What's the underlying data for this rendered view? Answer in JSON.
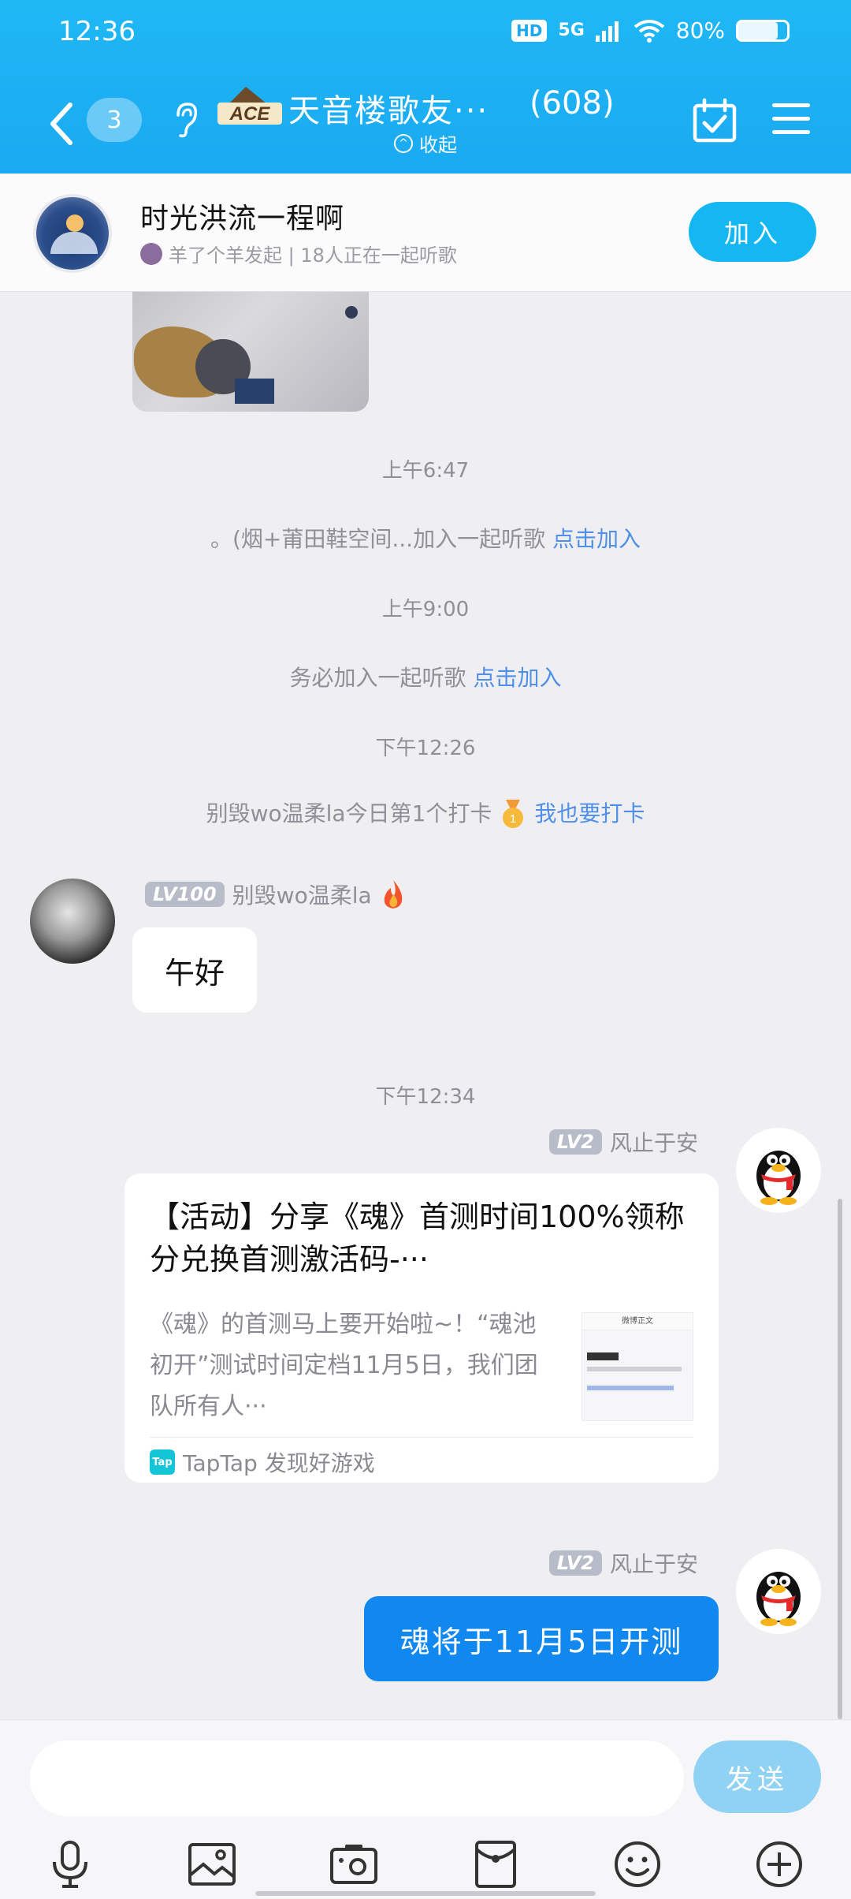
{
  "status_bar": {
    "time": "12:36",
    "network": "5G",
    "hd": "HD",
    "battery": "80%"
  },
  "header": {
    "unread_count": "3",
    "logo_text": "ACE",
    "group_title": "天音楼歌友···",
    "member_count": "(608)",
    "collapse_label": "收起"
  },
  "listen_together": {
    "room_name": "时光洪流一程啊",
    "subtitle": "羊了个羊发起 | 18人正在一起听歌",
    "join_label": "加入"
  },
  "messages": {
    "time_1": "上午6:47",
    "sys_1_text": "。(烟+莆田鞋空间...加入一起听歌 ",
    "sys_1_link": "点击加入",
    "time_2": "上午9:00",
    "sys_2_text": "务必加入一起听歌 ",
    "sys_2_link": "点击加入",
    "time_3": "下午12:26",
    "sys_3_text": "别毁wo温柔la今日第1个打卡",
    "sys_3_link": "我也要打卡",
    "msg_1": {
      "level": "LV100",
      "nickname": "别毁wo温柔la",
      "text": "午好"
    },
    "time_4": "下午12:34",
    "msg_2": {
      "level": "LV2",
      "nickname": "风止于安",
      "card_title": "【活动】分享《魂》首测时间100%领称分兑换首测激活码-···",
      "card_desc": "《魂》的首测马上要开始啦~！“魂池初开”测试时间定档11月5日，我们团队所有人···",
      "thumb_title": "微博正文",
      "source_icon": "Tap",
      "source": "TapTap 发现好游戏"
    },
    "msg_3": {
      "level": "LV2",
      "nickname": "风止于安",
      "text": "魂将于11月5日开测"
    }
  },
  "input": {
    "value": "",
    "placeholder": "",
    "send_label": "发送"
  },
  "colors": {
    "header_blue": "#1aa9f1",
    "bubble_blue": "#1188ef",
    "link_blue": "#4f8fe8"
  }
}
